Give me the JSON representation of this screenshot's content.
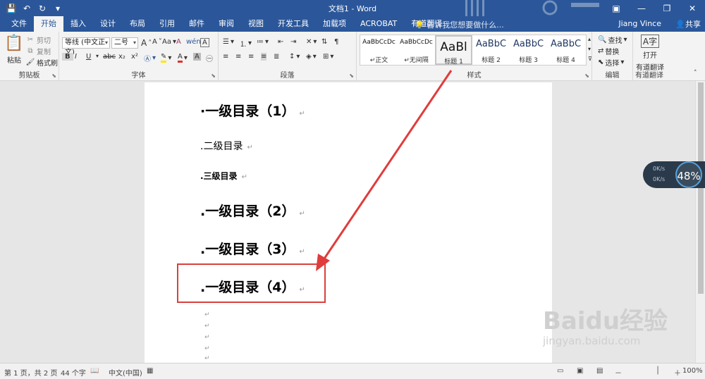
{
  "window": {
    "title": "文档1 - Word",
    "user": "Jiang Vince",
    "share_label": "共享"
  },
  "tabs": [
    "文件",
    "开始",
    "插入",
    "设计",
    "布局",
    "引用",
    "邮件",
    "审阅",
    "视图",
    "开发工具",
    "加载项",
    "ACROBAT",
    "有道翻译"
  ],
  "active_tab": "开始",
  "tell_me": "告诉我您想要做什么...",
  "ribbon": {
    "clipboard": {
      "label": "剪贴板",
      "paste": "粘贴",
      "cut": "剪切",
      "copy": "复制",
      "format_painter": "格式刷"
    },
    "font": {
      "label": "字体",
      "font_name": "等线 (中文正文)",
      "font_size": "二号",
      "bold": "B",
      "italic": "I",
      "underline": "U",
      "strike": "abc",
      "subscript": "x₂",
      "superscript": "x²",
      "grow": "A",
      "shrink": "A",
      "case": "Aa",
      "clear": "A",
      "wen": "wén",
      "char_border": "A"
    },
    "paragraph": {
      "label": "段落"
    },
    "styles": {
      "label": "样式",
      "items": [
        {
          "preview": "AaBbCcDc",
          "name": "↵正文"
        },
        {
          "preview": "AaBbCcDc",
          "name": "↵无间隔"
        },
        {
          "preview": "AaBl",
          "name": "标题 1"
        },
        {
          "preview": "AaBbC",
          "name": "标题 2"
        },
        {
          "preview": "AaBbC",
          "name": "标题 3"
        },
        {
          "preview": "AaBbC",
          "name": "标题 4"
        }
      ]
    },
    "editing": {
      "label": "编辑",
      "find": "查找",
      "replace": "替换",
      "select": "选择"
    },
    "youdao": {
      "label": "有道翻译",
      "open": "打开",
      "open2": "有道翻译"
    }
  },
  "document": {
    "lines": [
      {
        "text": "·一级目录（1）",
        "level": 1
      },
      {
        "text": ".二级目录",
        "level": 2
      },
      {
        "text": ".三级目录",
        "level": 3
      },
      {
        "text": ".一级目录（2）",
        "level": 1
      },
      {
        "text": ".一级目录（3）",
        "level": 1
      },
      {
        "text": ".一级目录（4）",
        "level": 1
      }
    ],
    "para_mark": "↵"
  },
  "net_widget": {
    "up": "0K/s",
    "down": "0K/s",
    "percent": "48%"
  },
  "status": {
    "page": "第 1 页，共 2 页",
    "words": "44 个字",
    "lang": "中文(中国)",
    "zoom": "100%"
  },
  "watermark": {
    "brand": "Baidu经验",
    "url": "jingyan.baidu.com"
  },
  "colors": {
    "word_blue": "#2b579a",
    "highlight_red": "#d9403a"
  }
}
